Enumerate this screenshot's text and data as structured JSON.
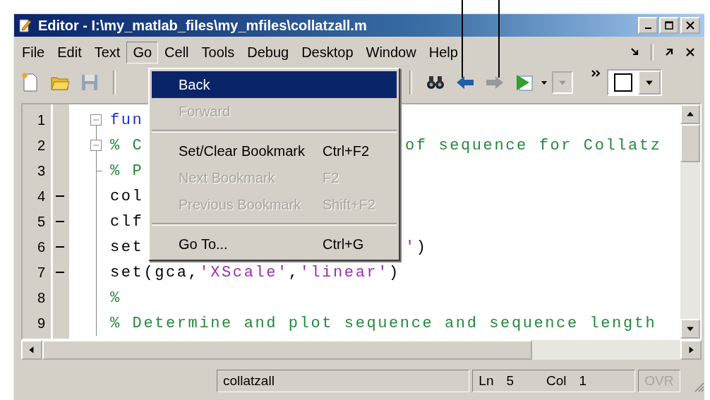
{
  "window": {
    "title": "Editor - I:\\my_matlab_files\\my_mfiles\\collatzall.m"
  },
  "menu_bar": [
    {
      "label": "File",
      "selected": false
    },
    {
      "label": "Edit",
      "selected": false
    },
    {
      "label": "Text",
      "selected": false
    },
    {
      "label": "Go",
      "selected": true
    },
    {
      "label": "Cell",
      "selected": false
    },
    {
      "label": "Tools",
      "selected": false
    },
    {
      "label": "Debug",
      "selected": false
    },
    {
      "label": "Desktop",
      "selected": false
    },
    {
      "label": "Window",
      "selected": false
    },
    {
      "label": "Help",
      "selected": false
    }
  ],
  "toolbar": {
    "left": [
      {
        "kind": "new",
        "disabled": false
      },
      {
        "kind": "open",
        "disabled": false
      },
      {
        "kind": "save",
        "disabled": true
      }
    ],
    "right": [
      {
        "kind": "find",
        "disabled": false
      },
      {
        "kind": "back",
        "disabled": false
      },
      {
        "kind": "forward",
        "disabled": true
      },
      {
        "kind": "run",
        "disabled": false
      }
    ]
  },
  "go_menu": [
    {
      "kind": "item",
      "label": "Back",
      "selected": true,
      "disabled": false
    },
    {
      "kind": "item",
      "label": "Forward",
      "selected": false,
      "disabled": true
    },
    {
      "kind": "separator"
    },
    {
      "kind": "item",
      "label": "Set/Clear Bookmark",
      "shortcut": "Ctrl+F2",
      "selected": false,
      "disabled": false
    },
    {
      "kind": "item",
      "label": "Next Bookmark",
      "shortcut": "F2",
      "selected": false,
      "disabled": true
    },
    {
      "kind": "item",
      "label": "Previous Bookmark",
      "shortcut": "Shift+F2",
      "selected": false,
      "disabled": true
    },
    {
      "kind": "separator"
    },
    {
      "kind": "item",
      "label": "Go To...",
      "shortcut": "Ctrl+G",
      "selected": false,
      "disabled": false
    }
  ],
  "editor": {
    "lines": [
      {
        "number": "1",
        "executable": false,
        "foldable": true,
        "left": [
          {
            "kind": "keyword",
            "text": "fun"
          }
        ]
      },
      {
        "number": "2",
        "executable": false,
        "foldable": true,
        "left": [
          {
            "kind": "comment",
            "text": "% C"
          }
        ],
        "right": [
          {
            "kind": "comment",
            "text": "of sequence for Collatz"
          }
        ]
      },
      {
        "number": "3",
        "executable": false,
        "foldable": false,
        "left": [
          {
            "kind": "comment",
            "text": "% P"
          }
        ]
      },
      {
        "number": "4",
        "executable": true,
        "foldable": false,
        "left": [
          {
            "kind": "plain",
            "text": "col"
          }
        ]
      },
      {
        "number": "5",
        "executable": true,
        "foldable": false,
        "left": [
          {
            "kind": "plain",
            "text": "clf"
          }
        ]
      },
      {
        "number": "6",
        "executable": true,
        "foldable": false,
        "left": [
          {
            "kind": "plain",
            "text": "set"
          }
        ],
        "right": [
          {
            "kind": "string",
            "text": "'"
          },
          {
            "kind": "plain",
            "text": ")"
          }
        ]
      },
      {
        "number": "7",
        "executable": true,
        "foldable": false,
        "left": [
          {
            "kind": "plain",
            "text": "set(gca,"
          },
          {
            "kind": "string",
            "text": "'XScale'"
          },
          {
            "kind": "plain",
            "text": ","
          },
          {
            "kind": "string",
            "text": "'linear'"
          },
          {
            "kind": "plain",
            "text": ")"
          }
        ]
      },
      {
        "number": "8",
        "executable": false,
        "foldable": false,
        "left": [
          {
            "kind": "comment",
            "text": "%"
          }
        ]
      },
      {
        "number": "9",
        "executable": false,
        "foldable": false,
        "left": [
          {
            "kind": "comment",
            "text": "% Determine and plot sequence and sequence length"
          }
        ]
      }
    ]
  },
  "status_bar": {
    "file": "collatzall",
    "line_label": "Ln",
    "line": "5",
    "col_label": "Col",
    "col": "1",
    "overwrite": {
      "label": "OVR",
      "disabled": true
    }
  }
}
